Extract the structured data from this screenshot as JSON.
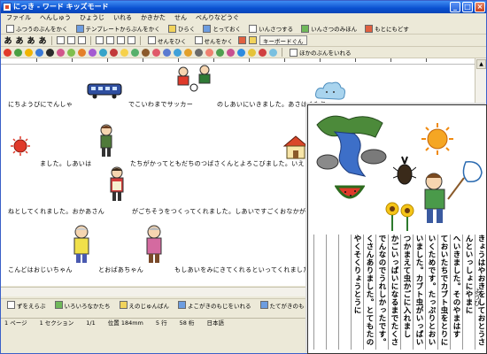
{
  "window": {
    "title": "にっき - ワード キッズモード"
  },
  "window_buttons": {
    "minimize": "_",
    "maximize": "□",
    "close": "×"
  },
  "menu": [
    "ファイル",
    "へんしゅう",
    "ひょうじ",
    "いれる",
    "かきかた",
    "せん",
    "べんりなどうぐ"
  ],
  "toolbar1": {
    "new_doc": "ふつうのぶんをかく",
    "template": "テンプレートからぶんをかく",
    "open": "ひらく",
    "save": "とっておく",
    "print": "いんさつする",
    "preview": "いんさつのみほん",
    "undo": "もとにもどす"
  },
  "toolbar2": {
    "font_a1": "あ",
    "font_a2": "あ",
    "font_a3": "あ",
    "font_a4": "あ",
    "mid_line": "せんをひく",
    "underline": "せんをかく",
    "keyboard": "キーボードぐん"
  },
  "toolbar3": {
    "tail": "ほかのぶんをいれる"
  },
  "doc_lines": {
    "l1a": "にちようびにでんしゃ",
    "l1b": "でこいわまでサッカー",
    "l1c": "のしあいにいきました。あさはくもり",
    "l2a": "ました。しあいは",
    "l2b": "たちがかってともだちのつばさくんとよろこびました。いえ",
    "l3a": "ねとしてくれました。おかあさん",
    "l3b": "がごちそうをつくってくれました。しあいですごくおなかがすいたので",
    "l4a": "こんどはおじいちゃん",
    "l4b": "とおばあちゃん",
    "l4c": "もしあいをみにきてくれるといってくれました。きょ"
  },
  "drawbar": {
    "draw": "ずをえらぶ",
    "shapes": "いろいろなかたち",
    "picture": "えのじゅんばん",
    "text_h": "よこがきのもじをいれる",
    "text_v": "たてがきのもじをいれる"
  },
  "status": {
    "page": "1 ページ",
    "section": "1 セクション",
    "pages": "1/1",
    "position": "位置 184mm",
    "line": "5 行",
    "col": "58 桁",
    "lang": "日本語"
  },
  "preview_columns": [
    "きょうはやおきをしておとうさ",
    "んといっしょにやまに",
    "へいきました。そのやまはす",
    "ておいたちでカブト虫をとりに",
    "いくためです。たっぷりとおい",
    "いました。カブト虫がいっぱい",
    "つかまえて虫かごに入れました。た",
    "かごいっぱいになるまでたくさん",
    "でんなのでうれしかったです。",
    "くさんありました。とてもたのしかっ",
    "やくそくりょうとうに"
  ],
  "preview_date": "ようび"
}
